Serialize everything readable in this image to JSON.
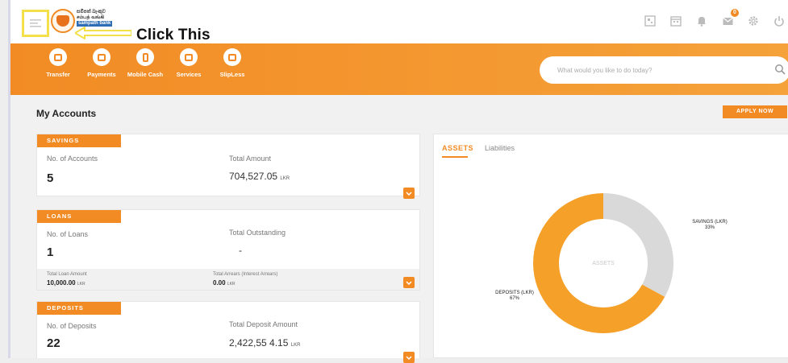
{
  "header": {
    "logo_lines": [
      "සම්පත් බැංකුව",
      "சம்பத் வங்கி",
      "sampath bank"
    ],
    "callout": "Click This",
    "icons": [
      "qr-icon",
      "calendar-icon",
      "bell-icon",
      "mail-icon",
      "gear-icon",
      "power-icon"
    ],
    "mail_badge": "0"
  },
  "nav": {
    "items": [
      {
        "label": "Transfer",
        "icon": "transfer-icon"
      },
      {
        "label": "Payments",
        "icon": "payments-icon"
      },
      {
        "label": "Mobile Cash",
        "icon": "mobile-cash-icon"
      },
      {
        "label": "Services",
        "icon": "services-icon"
      },
      {
        "label": "SlipLess",
        "icon": "slipless-icon"
      }
    ],
    "search_placeholder": "What would you like to do today?"
  },
  "main": {
    "title": "My Accounts",
    "apply_label": "APPLY NOW"
  },
  "cards": {
    "savings": {
      "tag": "SAVINGS",
      "count_label": "No. of Accounts",
      "count": "5",
      "amount_label": "Total Amount",
      "amount": "704,527.05",
      "currency": "LKR"
    },
    "loans": {
      "tag": "LOANS",
      "count_label": "No. of Loans",
      "count": "1",
      "amount_label": "Total Outstanding",
      "amount": "-",
      "sub_label_1": "Total Loan Amount",
      "sub_value_1": "10,000.00",
      "sub_label_2": "Total Arrears (Interest Arrears)",
      "sub_value_2": "0.00",
      "currency": "LKR"
    },
    "deposits": {
      "tag": "DEPOSITS",
      "count_label": "No. of Deposits",
      "count": "22",
      "amount_label": "Total Deposit Amount",
      "amount": "2,422,55 4.15",
      "currency": "LKR"
    }
  },
  "assets_panel": {
    "tabs": [
      "ASSETS",
      "Liabilities"
    ],
    "center_label": "ASSETS",
    "colors": {
      "deposits": "#f5a028",
      "savings": "#d9d9d9"
    }
  },
  "chart_data": {
    "type": "pie",
    "categories": [
      "DEPOSITS (LKR)",
      "SAVINGS (LKR)"
    ],
    "values": [
      67,
      33
    ],
    "labels": [
      "67%",
      "33%"
    ],
    "title": "",
    "center_text": "ASSETS"
  }
}
